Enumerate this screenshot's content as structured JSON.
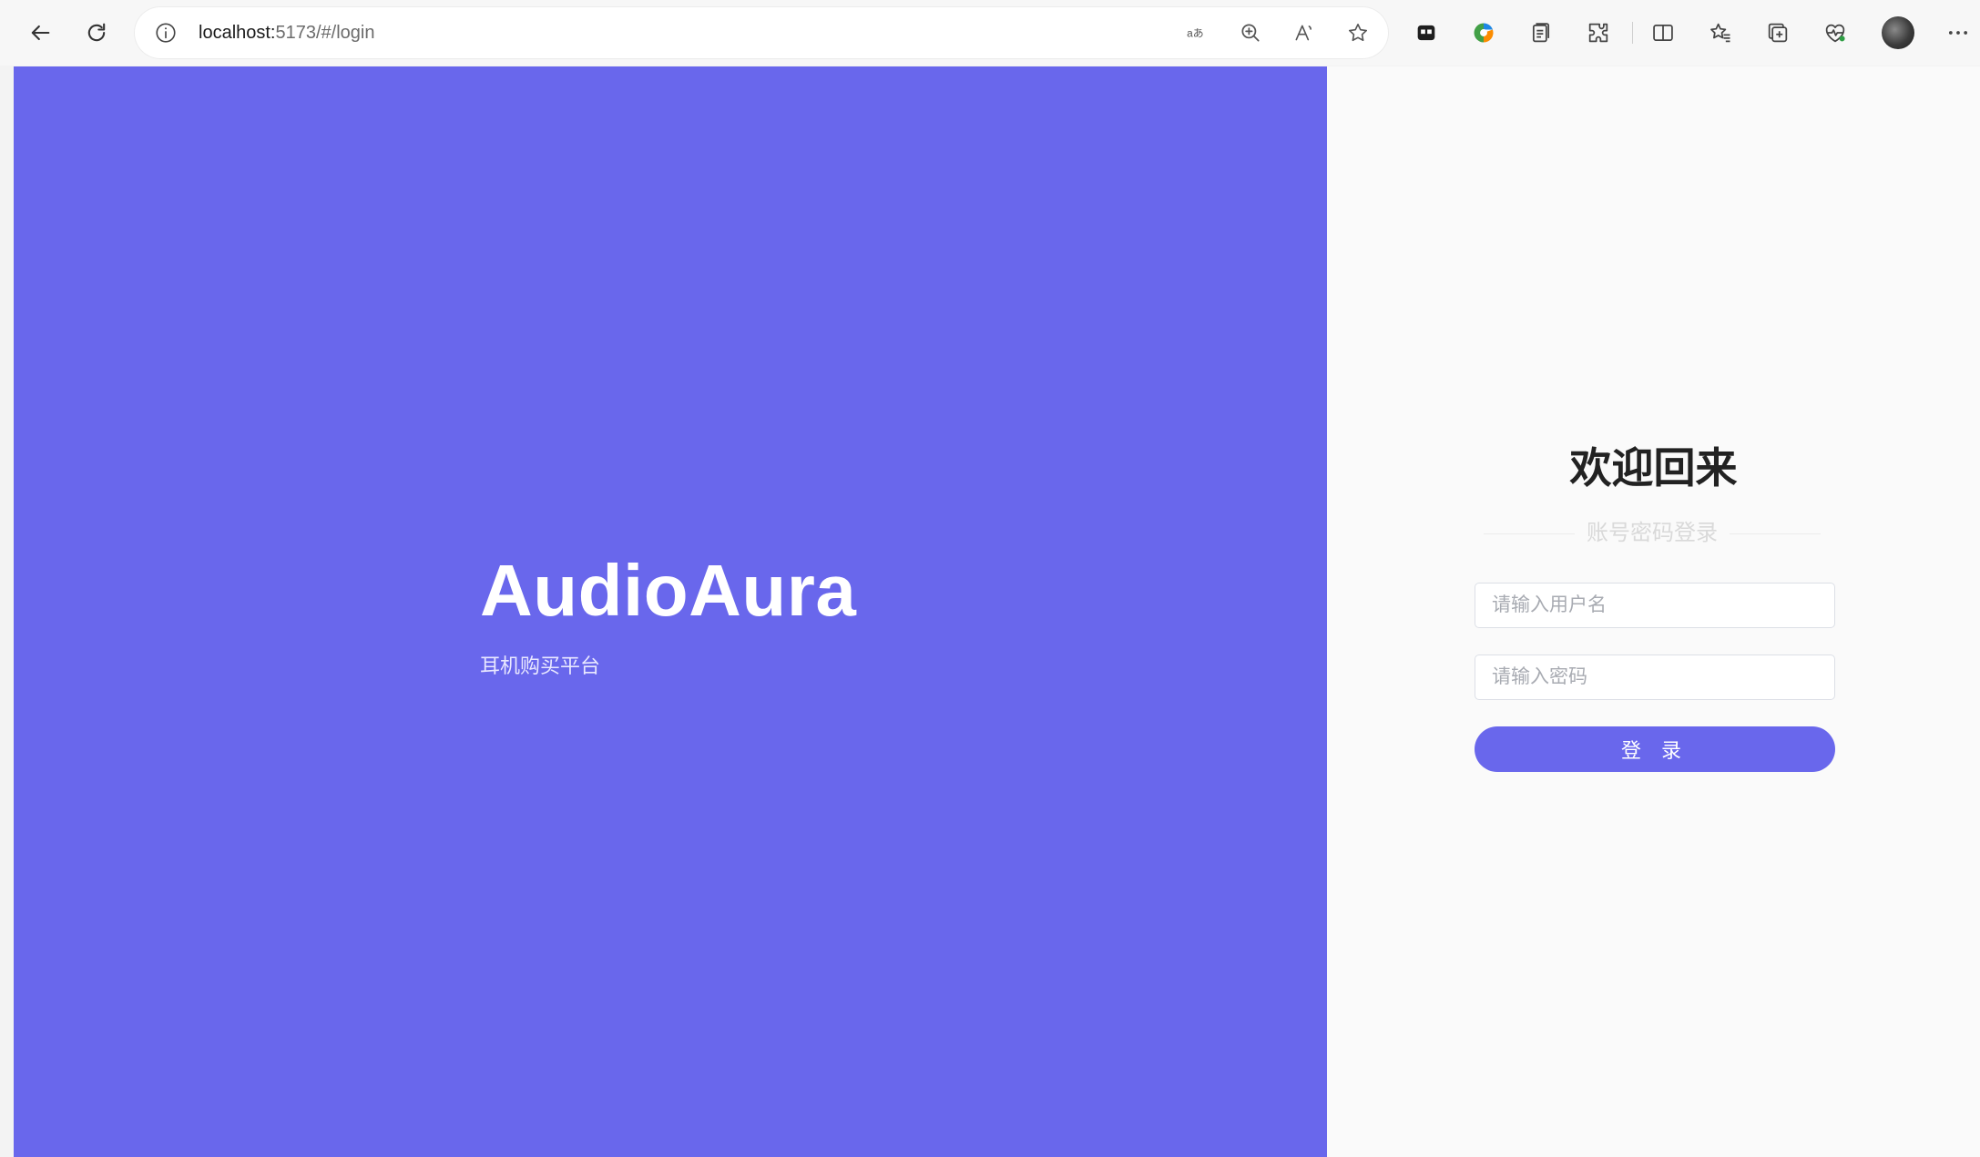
{
  "browser": {
    "url_host": "localhost:",
    "url_path": "5173/#/login",
    "icons": {
      "back": "back-arrow-icon",
      "reload": "reload-icon",
      "site_info": "info-icon",
      "translate": "translate-icon",
      "zoom": "zoom-icon",
      "read_aloud": "read-aloud-icon",
      "favorite": "star-icon",
      "extension_1": "extension-icon",
      "extension_2": "copilot-icon",
      "extension_3": "clipboard-icon",
      "extension_4": "puzzle-icon",
      "split_screen": "split-screen-icon",
      "favorites": "favorites-icon",
      "collections": "collections-icon",
      "performance": "heart-pulse-icon",
      "profile": "avatar",
      "more": "more-icon"
    }
  },
  "hero": {
    "title": "AudioAura",
    "subtitle": "耳机购买平台",
    "background_color": "#6967ec"
  },
  "login": {
    "heading": "欢迎回来",
    "method_label": "账号密码登录",
    "username_placeholder": "请输入用户名",
    "password_placeholder": "请输入密码",
    "submit_label": "登 录",
    "accent_color": "#6967ec"
  }
}
